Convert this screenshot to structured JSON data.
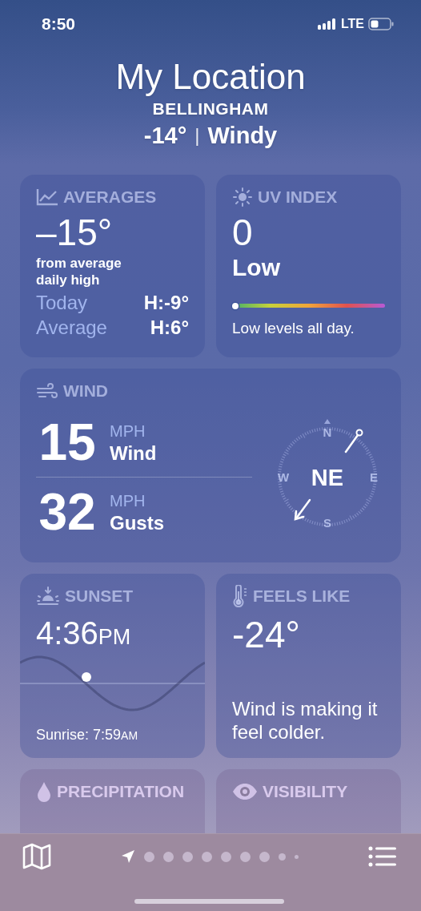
{
  "status_bar": {
    "time": "8:50",
    "network": "LTE"
  },
  "header": {
    "title": "My Location",
    "city": "BELLINGHAM",
    "current": "-14°",
    "separator": "|",
    "condition": "Windy"
  },
  "averages": {
    "title": "AVERAGES",
    "value": "–15°",
    "caption": "from average daily high",
    "rows": [
      {
        "label": "Today",
        "value": "H:-9°"
      },
      {
        "label": "Average",
        "value": "H:6°"
      }
    ]
  },
  "uv_index": {
    "title": "UV INDEX",
    "value": "0",
    "category": "Low",
    "level": 0,
    "summary": "Low levels all day."
  },
  "wind": {
    "title": "WIND",
    "readings": [
      {
        "value": "15",
        "unit": "MPH",
        "label": "Wind"
      },
      {
        "value": "32",
        "unit": "MPH",
        "label": "Gusts"
      }
    ],
    "compass": {
      "direction": "NE",
      "north": "N",
      "east": "E",
      "south": "S",
      "west": "W"
    }
  },
  "sunset": {
    "title": "SUNSET",
    "time": "4:36",
    "period": "PM",
    "sunrise": "Sunrise: 7:59",
    "sunrise_period": "AM"
  },
  "feels_like": {
    "title": "FEELS LIKE",
    "value": "-24°",
    "summary": "Wind is making it feel colder."
  },
  "precipitation": {
    "title": "PRECIPITATION"
  },
  "visibility": {
    "title": "VISIBILITY"
  },
  "page_indicator": [
    {
      "kind": "location",
      "selected": true
    },
    {
      "kind": "dot",
      "selected": false
    },
    {
      "kind": "dot",
      "selected": false
    },
    {
      "kind": "dot",
      "selected": false
    },
    {
      "kind": "dot",
      "selected": false
    },
    {
      "kind": "dot",
      "selected": false
    },
    {
      "kind": "dot",
      "selected": false
    },
    {
      "kind": "dot",
      "selected": false
    },
    {
      "kind": "small",
      "selected": false
    },
    {
      "kind": "tiny",
      "selected": false
    }
  ]
}
